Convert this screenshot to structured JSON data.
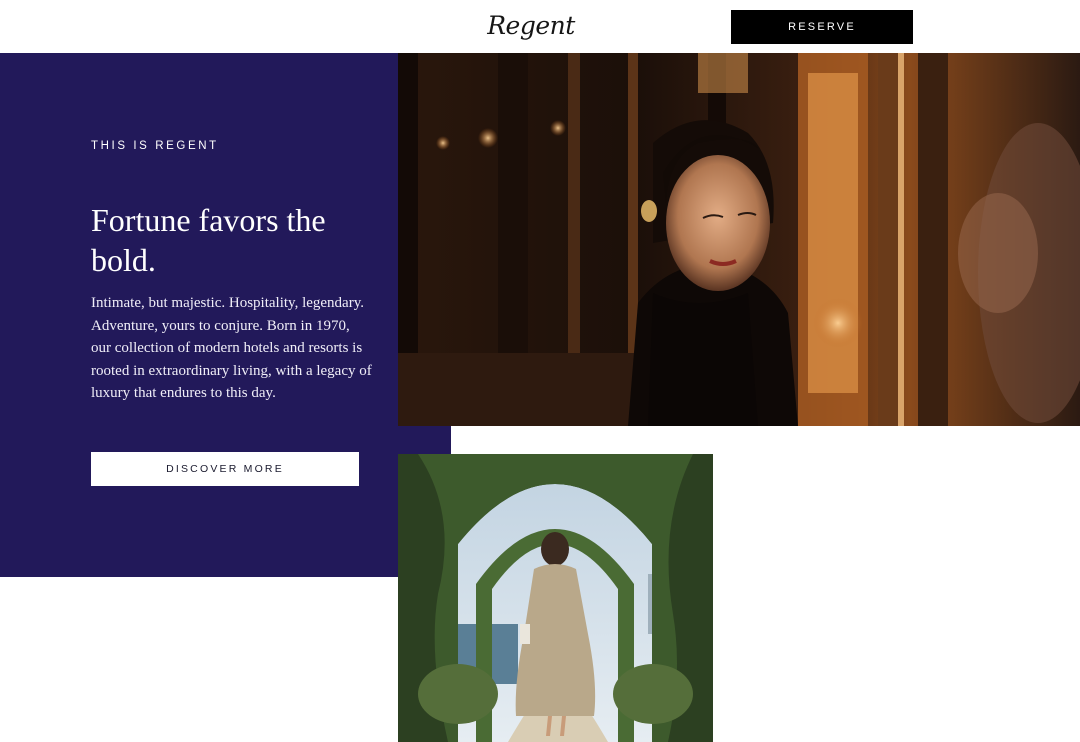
{
  "header": {
    "logo_text": "Regent",
    "reserve_label": "RESERVE"
  },
  "intro": {
    "eyebrow": "THIS IS REGENT",
    "headline": "Fortune favors the bold.",
    "body": "Intimate, but majestic. Hospitality, legendary. Adventure, yours to conjure. Born in 1970, our collection of modern hotels and resorts is rooted in extraordinary living, with a legacy of luxury that endures to this day.",
    "cta_label": "DISCOVER MORE"
  },
  "colors": {
    "panel_bg": "#22195a",
    "reserve_bg": "#000000",
    "cta_bg": "#ffffff"
  },
  "images": {
    "portrait": "woman-in-warm-lit-interior-photo",
    "garden": "woman-walking-through-garden-arch-photo"
  }
}
